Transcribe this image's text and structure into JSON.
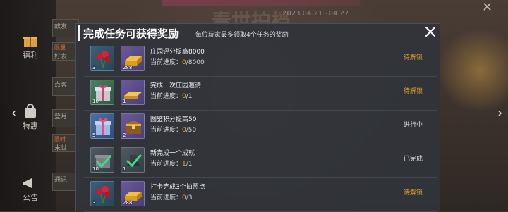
{
  "background": {
    "date_text": "2023.04.21~04.27",
    "title_text": "春世拍档"
  },
  "rail": {
    "items": [
      {
        "label": "福利",
        "icon": "gift-icon"
      },
      {
        "label": "特惠",
        "icon": "bag-icon"
      },
      {
        "label": "公告",
        "icon": "megaphone-icon"
      }
    ],
    "list_items": [
      {
        "text": "故友"
      },
      {
        "text": "好友"
      },
      {
        "text": "点客"
      },
      {
        "text": "登月"
      },
      {
        "text": "末世"
      },
      {
        "text": "通讯"
      }
    ],
    "list_badges": [
      "限量",
      "限时"
    ]
  },
  "modal": {
    "title": "完成任务可获得奖励",
    "subtitle": "每位玩家最多领取4个任务的奖励",
    "progress_label": "当前进度：",
    "tasks": [
      {
        "title": "庄园评分提高8000",
        "current": "0",
        "target": "/8000",
        "status": "待解锁",
        "status_color": "#e0a030",
        "rewards": [
          {
            "icon": "rose-bouquet-icon",
            "count": "3"
          },
          {
            "icon": "gold-bars-icon",
            "count": "288"
          }
        ]
      },
      {
        "title": "完成一次庄园邀请",
        "current": "0",
        "target": "/1",
        "status": "待解锁",
        "status_color": "#e0a030",
        "rewards": [
          {
            "icon": "gift-box-icon",
            "count": "10"
          },
          {
            "icon": "gold-ingot-icon",
            "count": "1"
          }
        ]
      },
      {
        "title": "图鉴积分提高50",
        "current": "0",
        "target": "/50",
        "status": "进行中",
        "status_color": "#e0e0e0",
        "rewards": [
          {
            "icon": "gift-box-icon",
            "count": "5"
          },
          {
            "icon": "treasure-chest-icon",
            "count": "2"
          }
        ]
      },
      {
        "title": "新完成一个成就",
        "current": "1",
        "target": "/1",
        "status": "已完成",
        "status_color": "#e0e0e0",
        "rewards": [
          {
            "icon": "gift-box-checked-icon",
            "count": "10"
          },
          {
            "icon": "trophy-stand-checked-icon",
            "count": "1"
          }
        ]
      },
      {
        "title": "打卡完成3个拍照点",
        "current": "0",
        "target": "/3",
        "status": "待解锁",
        "status_color": "#e0a030",
        "rewards": [
          {
            "icon": "rose-bouquet-icon",
            "count": "3"
          },
          {
            "icon": "gold-bars-icon",
            "count": "288"
          }
        ]
      }
    ]
  }
}
